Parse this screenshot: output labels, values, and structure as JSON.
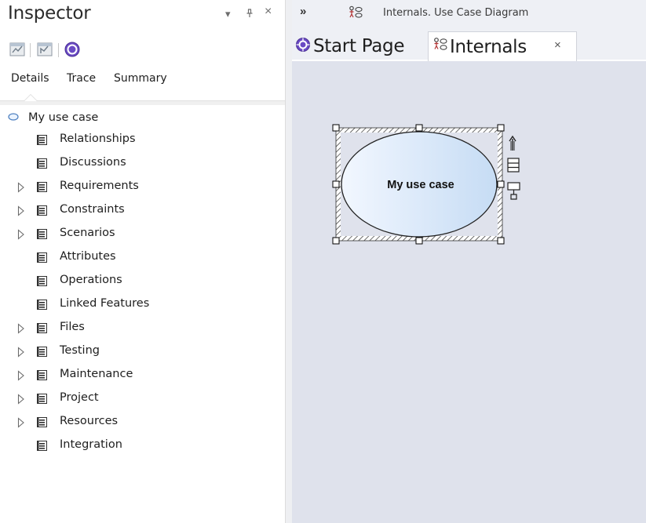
{
  "inspector": {
    "title": "Inspector",
    "controls": {
      "dropdown": "▾",
      "pin": "⊥",
      "close": "×"
    },
    "toolbar": [
      "properties-icon",
      "diagram-icon",
      "help-icon"
    ],
    "tabs": [
      {
        "label": "Details",
        "active": true
      },
      {
        "label": "Trace",
        "active": false
      },
      {
        "label": "Summary",
        "active": false
      }
    ],
    "tree": {
      "root": {
        "label": "My use case",
        "icon": "use-case-icon"
      },
      "items": [
        {
          "label": "Relationships",
          "expandable": false
        },
        {
          "label": "Discussions",
          "expandable": false
        },
        {
          "label": "Requirements",
          "expandable": true
        },
        {
          "label": "Constraints",
          "expandable": true
        },
        {
          "label": "Scenarios",
          "expandable": true
        },
        {
          "label": "Attributes",
          "expandable": false
        },
        {
          "label": "Operations",
          "expandable": false
        },
        {
          "label": "Linked Features",
          "expandable": false
        },
        {
          "label": "Files",
          "expandable": true
        },
        {
          "label": "Testing",
          "expandable": true
        },
        {
          "label": "Maintenance",
          "expandable": true
        },
        {
          "label": "Project",
          "expandable": true
        },
        {
          "label": "Resources",
          "expandable": true
        },
        {
          "label": "Integration",
          "expandable": false
        }
      ]
    }
  },
  "diagram": {
    "breadcrumb": {
      "chevron": "»",
      "text": "Internals.  Use Case Diagram"
    },
    "tabs": [
      {
        "label": "Start Page",
        "icon": "start-page-icon",
        "active": false
      },
      {
        "label": "Internals",
        "icon": "use-case-diagram-icon",
        "active": true,
        "close": "×"
      }
    ],
    "element": {
      "label": "My use case",
      "selected": true
    },
    "colors": {
      "canvas": "#dfe2ec",
      "usecase_fill_start": "#f2f7ff",
      "usecase_fill_end": "#c6dcf4",
      "accent": "#5a3fb0"
    }
  }
}
